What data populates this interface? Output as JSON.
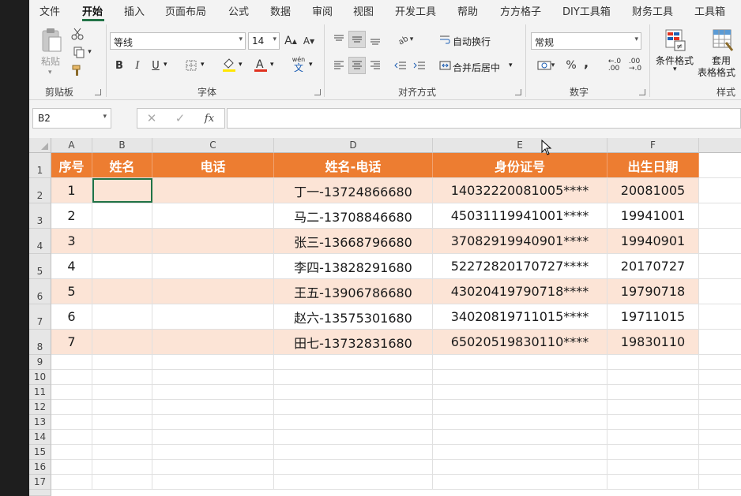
{
  "menu": {
    "tabs": [
      "文件",
      "开始",
      "插入",
      "页面布局",
      "公式",
      "数据",
      "审阅",
      "视图",
      "开发工具",
      "帮助",
      "方方格子",
      "DIY工具箱",
      "财务工具",
      "工具箱"
    ],
    "active": "开始"
  },
  "ribbon": {
    "clipboard": {
      "paste_label": "粘贴",
      "group_label": "剪贴板"
    },
    "font": {
      "font_name": "等线",
      "font_size": "14",
      "bold": "B",
      "italic": "I",
      "underline": "U",
      "wen": "wén",
      "wen_char": "文",
      "group_label": "字体"
    },
    "align": {
      "wrap_text": "自动换行",
      "merge_center": "合并后居中",
      "group_label": "对齐方式"
    },
    "number": {
      "format": "常规",
      "percent": "%",
      "comma": ",",
      "group_label": "数字"
    },
    "styles": {
      "conditional_format": "条件格式",
      "table_format_1": "套用",
      "table_format_2": "表格格式",
      "group_label": "样式"
    }
  },
  "formula_bar": {
    "name_box": "B2",
    "formula": "",
    "fx": "fx"
  },
  "sheet": {
    "columns": [
      "A",
      "B",
      "C",
      "D",
      "E",
      "F"
    ],
    "row_numbers": [
      "1",
      "2",
      "3",
      "4",
      "5",
      "6",
      "7",
      "8",
      "9",
      "10",
      "11",
      "12",
      "13",
      "14",
      "15",
      "16",
      "17"
    ],
    "header": [
      "序号",
      "姓名",
      "电话",
      "姓名-电话",
      "身份证号",
      "出生日期"
    ],
    "rows": [
      [
        "1",
        "",
        "",
        "丁一-13724866680",
        "14032220081005****",
        "20081005"
      ],
      [
        "2",
        "",
        "",
        "马二-13708846680",
        "45031119941001****",
        "19941001"
      ],
      [
        "3",
        "",
        "",
        "张三-13668796680",
        "37082919940901****",
        "19940901"
      ],
      [
        "4",
        "",
        "",
        "李四-13828291680",
        "52272820170727****",
        "20170727"
      ],
      [
        "5",
        "",
        "",
        "王五-13906786680",
        "43020419790718****",
        "19790718"
      ],
      [
        "6",
        "",
        "",
        "赵六-13575301680",
        "34020819711015****",
        "19711015"
      ],
      [
        "7",
        "",
        "",
        "田七-13732831680",
        "65020519830110****",
        "19830110"
      ]
    ]
  },
  "colors": {
    "header_fill": "#ed7d31",
    "band_fill": "#fce4d6",
    "accent": "#217346"
  }
}
